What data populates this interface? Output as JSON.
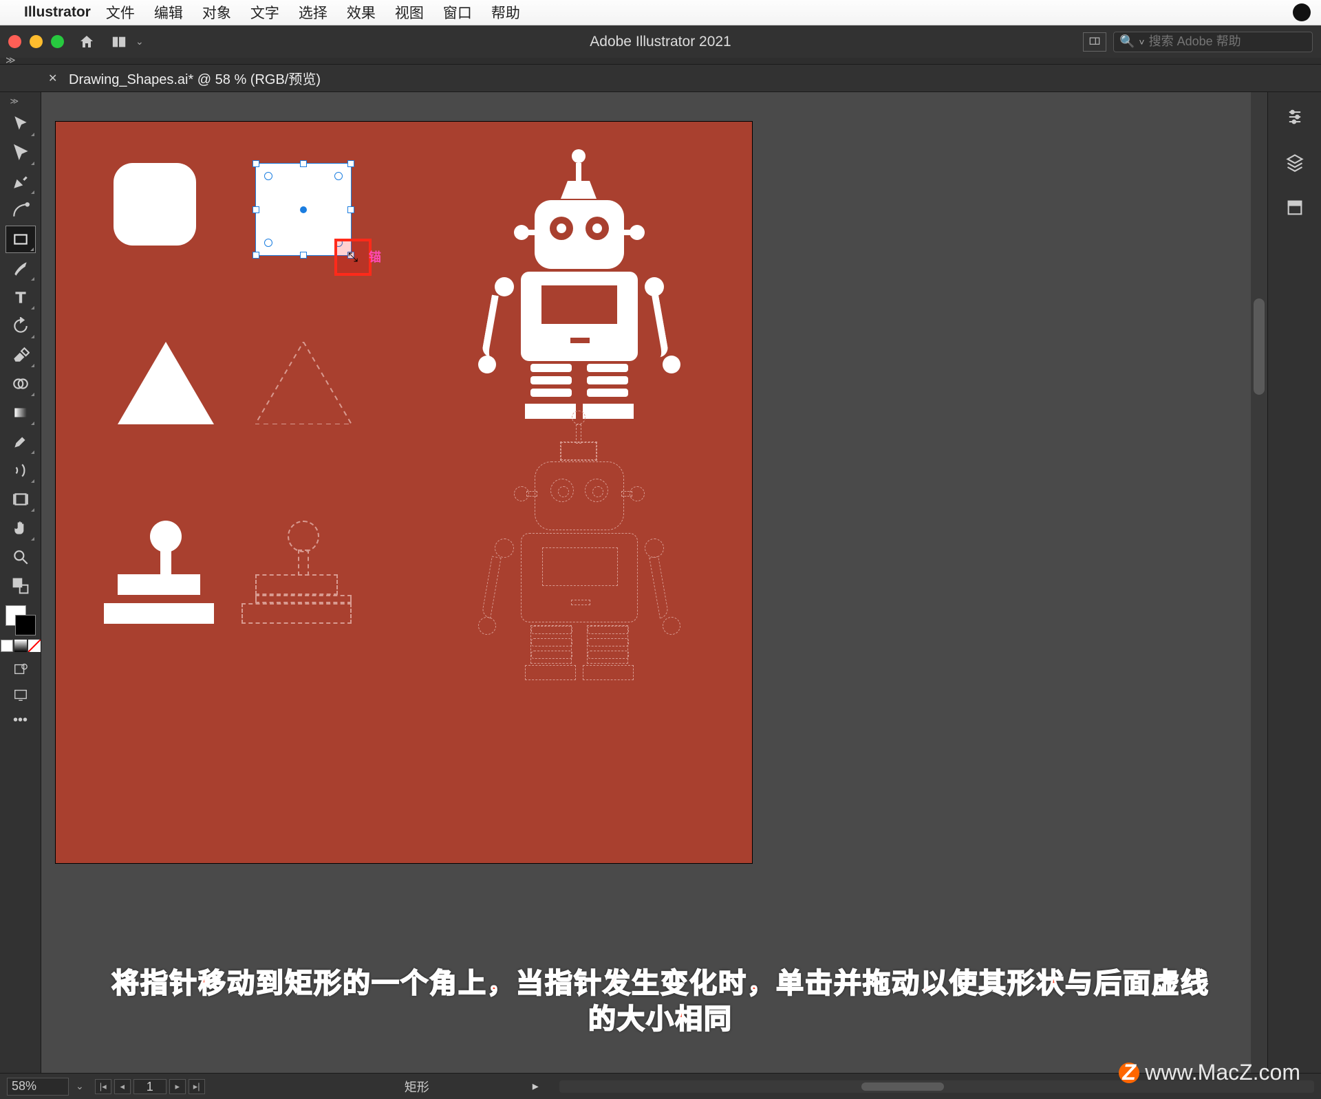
{
  "menubar": {
    "app_name": "Illustrator",
    "items": [
      "文件",
      "编辑",
      "对象",
      "文字",
      "选择",
      "效果",
      "视图",
      "窗口",
      "帮助"
    ]
  },
  "chrome": {
    "title": "Adobe Illustrator 2021",
    "search_placeholder": "搜索 Adobe 帮助"
  },
  "tab": {
    "label": "Drawing_Shapes.ai* @ 58 % (RGB/预览)"
  },
  "status": {
    "zoom": "58%",
    "artboard_num": "1",
    "shape_label": "矩形"
  },
  "cursor_hint": "锚",
  "instruction": {
    "line1": "将指针移动到矩形的一个角上，当指针发生变化时，单击并拖动以使其形状与后面虚线",
    "line2": "的大小相同"
  },
  "watermark": "www.MacZ.com",
  "icons": {
    "home": "home-icon",
    "layout": "layout-icon",
    "search": "search-icon",
    "properties": "properties-icon",
    "layers": "layers-icon",
    "libraries": "libraries-icon"
  }
}
